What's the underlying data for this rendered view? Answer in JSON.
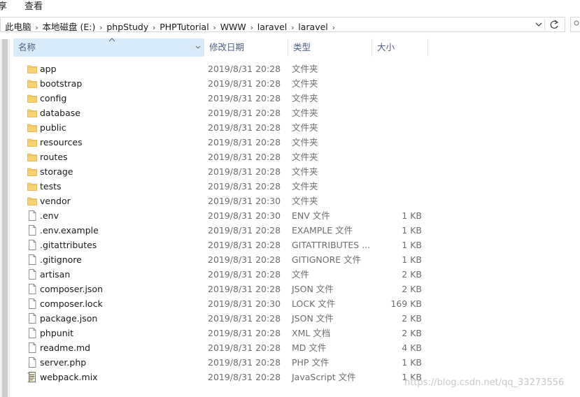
{
  "ribbon": {
    "tab_share": "享",
    "tab_view": "查看"
  },
  "address": {
    "crumbs": [
      "此电脑",
      "本地磁盘 (E:)",
      "phpStudy",
      "PHPTutorial",
      "WWW",
      "laravel",
      "laravel"
    ],
    "dropdown_icon": "chevron-down-icon",
    "refresh_icon": "refresh-icon"
  },
  "columns": {
    "name": "名称",
    "date": "修改日期",
    "type": "类型",
    "size": "大小"
  },
  "files": [
    {
      "name": "app",
      "date": "2019/8/31 20:28",
      "type": "文件夹",
      "size": "",
      "icon": "folder"
    },
    {
      "name": "bootstrap",
      "date": "2019/8/31 20:28",
      "type": "文件夹",
      "size": "",
      "icon": "folder"
    },
    {
      "name": "config",
      "date": "2019/8/31 20:28",
      "type": "文件夹",
      "size": "",
      "icon": "folder"
    },
    {
      "name": "database",
      "date": "2019/8/31 20:28",
      "type": "文件夹",
      "size": "",
      "icon": "folder"
    },
    {
      "name": "public",
      "date": "2019/8/31 20:28",
      "type": "文件夹",
      "size": "",
      "icon": "folder"
    },
    {
      "name": "resources",
      "date": "2019/8/31 20:28",
      "type": "文件夹",
      "size": "",
      "icon": "folder"
    },
    {
      "name": "routes",
      "date": "2019/8/31 20:28",
      "type": "文件夹",
      "size": "",
      "icon": "folder"
    },
    {
      "name": "storage",
      "date": "2019/8/31 20:28",
      "type": "文件夹",
      "size": "",
      "icon": "folder"
    },
    {
      "name": "tests",
      "date": "2019/8/31 20:28",
      "type": "文件夹",
      "size": "",
      "icon": "folder"
    },
    {
      "name": "vendor",
      "date": "2019/8/31 20:30",
      "type": "文件夹",
      "size": "",
      "icon": "folder"
    },
    {
      "name": ".env",
      "date": "2019/8/31 20:30",
      "type": "ENV 文件",
      "size": "1 KB",
      "icon": "file"
    },
    {
      "name": ".env.example",
      "date": "2019/8/31 20:28",
      "type": "EXAMPLE 文件",
      "size": "1 KB",
      "icon": "file"
    },
    {
      "name": ".gitattributes",
      "date": "2019/8/31 20:28",
      "type": "GITATTRIBUTES ...",
      "size": "1 KB",
      "icon": "file"
    },
    {
      "name": ".gitignore",
      "date": "2019/8/31 20:28",
      "type": "GITIGNORE 文件",
      "size": "1 KB",
      "icon": "file"
    },
    {
      "name": "artisan",
      "date": "2019/8/31 20:28",
      "type": "文件",
      "size": "2 KB",
      "icon": "file"
    },
    {
      "name": "composer.json",
      "date": "2019/8/31 20:28",
      "type": "JSON 文件",
      "size": "2 KB",
      "icon": "file"
    },
    {
      "name": "composer.lock",
      "date": "2019/8/31 20:30",
      "type": "LOCK 文件",
      "size": "169 KB",
      "icon": "file"
    },
    {
      "name": "package.json",
      "date": "2019/8/31 20:28",
      "type": "JSON 文件",
      "size": "2 KB",
      "icon": "file"
    },
    {
      "name": "phpunit",
      "date": "2019/8/31 20:28",
      "type": "XML 文档",
      "size": "2 KB",
      "icon": "file"
    },
    {
      "name": "readme.md",
      "date": "2019/8/31 20:28",
      "type": "MD 文件",
      "size": "4 KB",
      "icon": "file"
    },
    {
      "name": "server.php",
      "date": "2019/8/31 20:28",
      "type": "PHP 文件",
      "size": "1 KB",
      "icon": "file"
    },
    {
      "name": "webpack.mix",
      "date": "2019/8/31 20:28",
      "type": "JavaScript 文件",
      "size": "1 KB",
      "icon": "script"
    }
  ],
  "watermark": "https://blog.csdn.net/qq_33273556",
  "colors": {
    "header_selected": "#d9ebf9",
    "header_text": "#4d6082",
    "folder": "#f7d26e",
    "muted_text": "#6d6d6d"
  }
}
